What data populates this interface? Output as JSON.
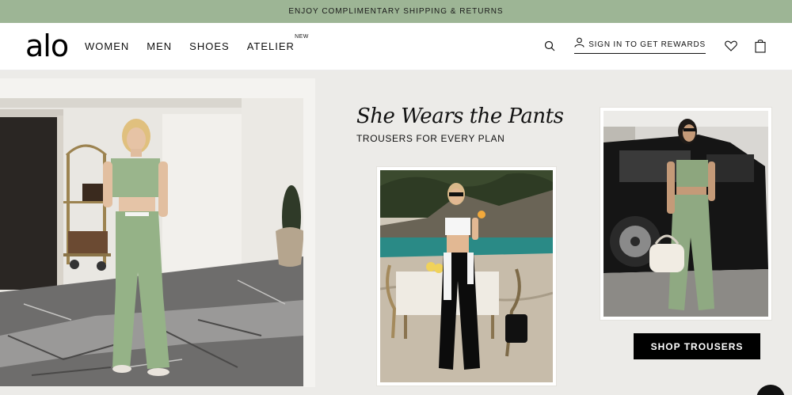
{
  "promo": {
    "text": "ENJOY COMPLIMENTARY SHIPPING & RETURNS"
  },
  "header": {
    "logo": "alo",
    "nav": [
      {
        "label": "WOMEN"
      },
      {
        "label": "MEN"
      },
      {
        "label": "SHOES"
      },
      {
        "label": "ATELIER",
        "badge": "NEW"
      }
    ],
    "signin_label": "SIGN IN TO GET REWARDS",
    "icons": [
      "search-icon",
      "user-icon",
      "heart-icon",
      "shopping-bag-icon"
    ]
  },
  "hero": {
    "headline": "She Wears the Pants",
    "subhead": "TROUSERS FOR EVERY PLAN",
    "cta_label": "SHOP TROUSERS"
  },
  "colors": {
    "promo_bg": "#9db595",
    "hero_bg": "#ecebe8",
    "cta_bg": "#000000",
    "trouser_green": "#95b287"
  }
}
